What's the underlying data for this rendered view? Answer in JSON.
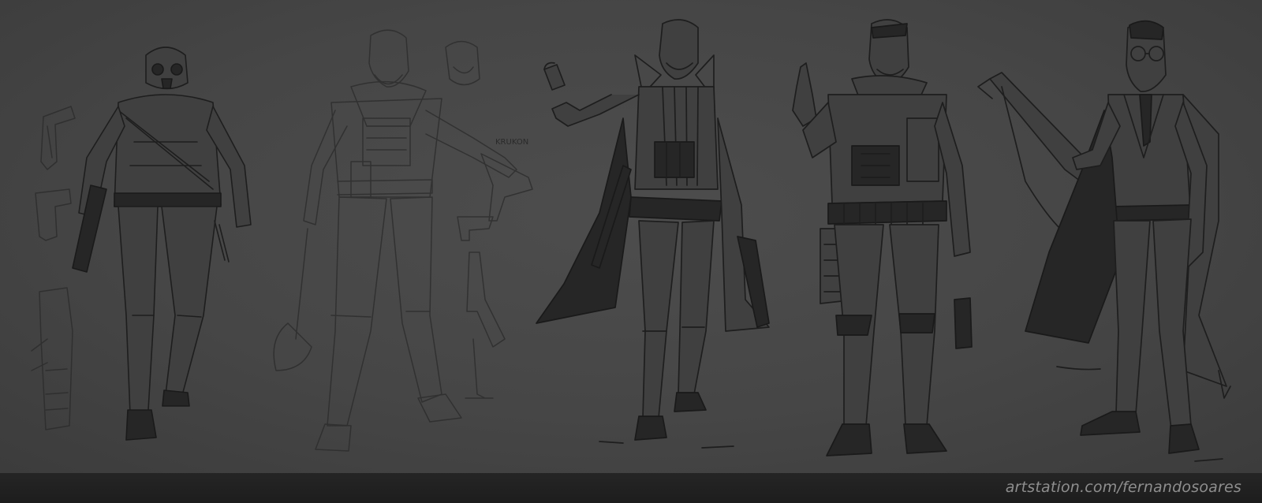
{
  "artwork": {
    "subject": "character concept sketches",
    "figure_count": 5
  },
  "handwritten_note": "KRUKON",
  "footer": {
    "watermark": "artstation.com/fernandosoares"
  },
  "colors": {
    "background": "#464646",
    "line": "#1e1e1e",
    "footer_bar": "#222222",
    "watermark_text": "#8e8e8e"
  }
}
